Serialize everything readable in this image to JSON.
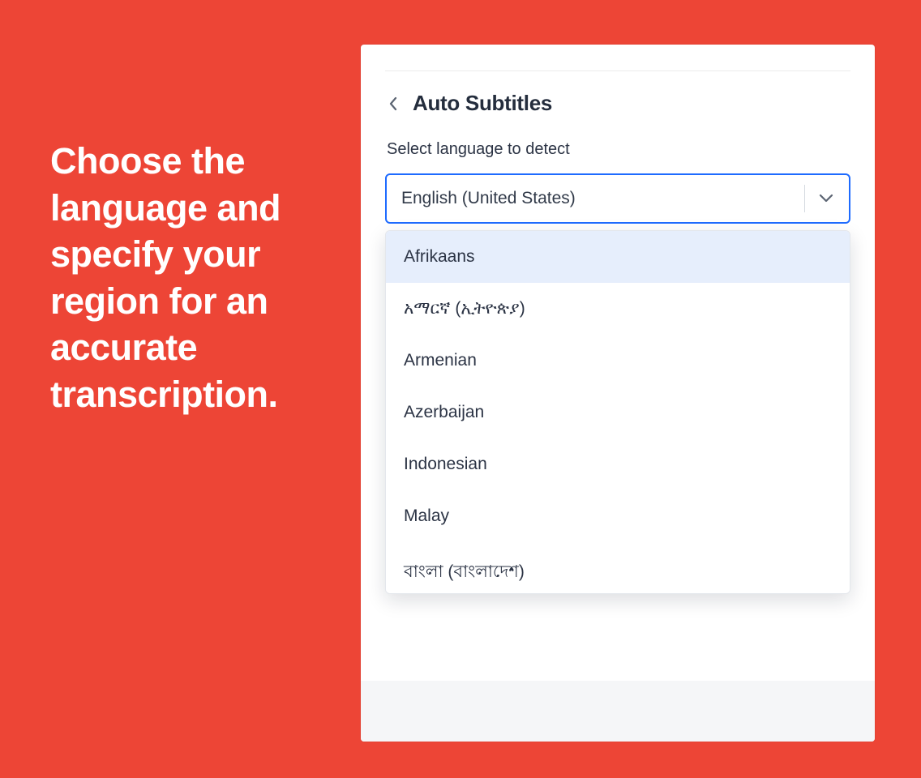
{
  "hero": {
    "text": "Choose the language and specify your region for an accurate transcription."
  },
  "panel": {
    "title": "Auto Subtitles",
    "section_label": "Select language to detect",
    "select_value": "English (United States)",
    "options": [
      "Afrikaans",
      "አማርኛ (ኢትዮጵያ)",
      "Armenian",
      "Azerbaijan",
      "Indonesian",
      "Malay",
      "বাংলা (বাংলাদেশ)"
    ]
  }
}
